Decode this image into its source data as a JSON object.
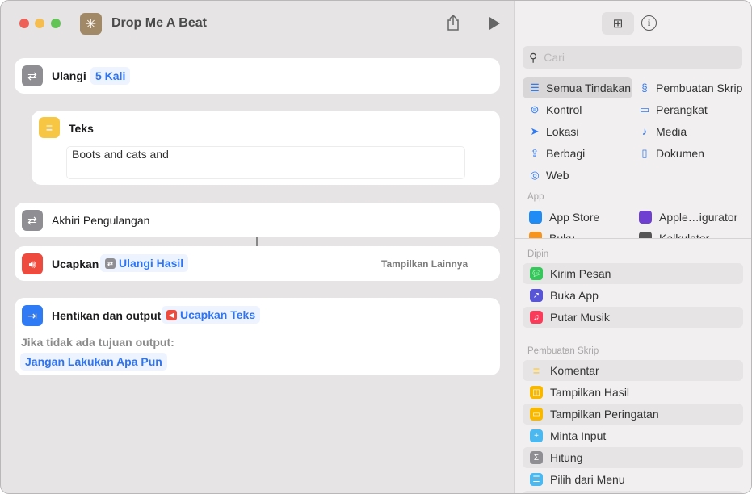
{
  "window": {
    "title": "Drop Me A Beat"
  },
  "editor": {
    "repeat": {
      "title": "Ulangi",
      "count": "5 Kali"
    },
    "text": {
      "title": "Teks",
      "value": "Boots and cats and"
    },
    "end_repeat": {
      "title": "Akhiri Pengulangan"
    },
    "speak": {
      "title": "Ucapkan",
      "input": "Ulangi Hasil",
      "more": "Tampilkan Lainnya"
    },
    "stop": {
      "title": "Hentikan dan output",
      "input": "Ucapkan Teks",
      "fallback_label": "Jika tidak ada tujuan output:",
      "fallback_value": "Jangan Lakukan Apa Pun"
    }
  },
  "sidebar": {
    "search_placeholder": "Cari",
    "categories": [
      {
        "label": "Semua Tindakan",
        "icon": "list-icon"
      },
      {
        "label": "Pembuatan Skrip",
        "icon": "scripting-icon"
      },
      {
        "label": "Kontrol",
        "icon": "toggle-icon"
      },
      {
        "label": "Perangkat",
        "icon": "display-icon"
      },
      {
        "label": "Lokasi",
        "icon": "location-icon"
      },
      {
        "label": "Media",
        "icon": "music-note-icon"
      },
      {
        "label": "Berbagi",
        "icon": "share-icon"
      },
      {
        "label": "Dokumen",
        "icon": "document-icon"
      },
      {
        "label": "Web",
        "icon": "compass-icon"
      }
    ],
    "apps_header": "App",
    "apps": [
      {
        "label": "App Store"
      },
      {
        "label": "Apple…igurator"
      },
      {
        "label": "Buku"
      },
      {
        "label": "Kalkulator"
      }
    ],
    "pinned_header": "Dipin",
    "pinned": [
      {
        "label": "Kirim Pesan",
        "color": "#34c759"
      },
      {
        "label": "Buka App",
        "color": "#5856d6"
      },
      {
        "label": "Putar Musik",
        "color": "#fa3c5a"
      }
    ],
    "scripting_header": "Pembuatan Skrip",
    "scripting": [
      {
        "label": "Komentar",
        "color": "#f5c333"
      },
      {
        "label": "Tampilkan Hasil",
        "color": "#f8b800"
      },
      {
        "label": "Tampilkan Peringatan",
        "color": "#f8b800"
      },
      {
        "label": "Minta Input",
        "color": "#4cb8f0"
      },
      {
        "label": "Hitung",
        "color": "#8e8e93"
      },
      {
        "label": "Pilih dari Menu",
        "color": "#4cb8f0"
      }
    ]
  }
}
